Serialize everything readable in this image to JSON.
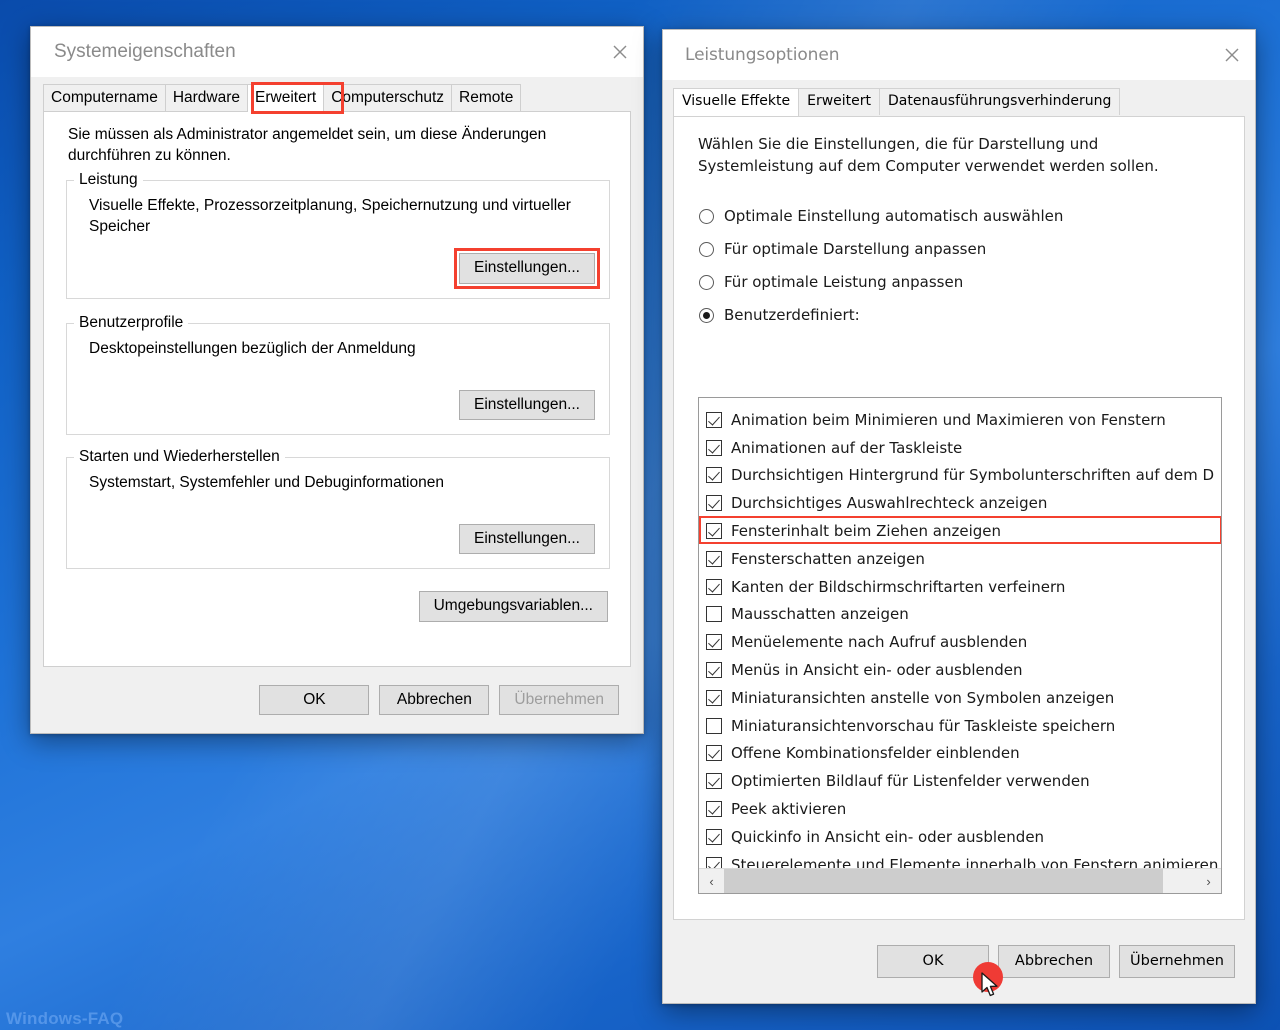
{
  "desktop": {
    "watermark": "Windows-FAQ"
  },
  "left_window": {
    "title": "Systemeigenschaften",
    "close_icon": "close-icon",
    "tabs": [
      {
        "label": "Computername",
        "active": false
      },
      {
        "label": "Hardware",
        "active": false
      },
      {
        "label": "Erweitert",
        "active": true,
        "highlighted": true
      },
      {
        "label": "Computerschutz",
        "active": false
      },
      {
        "label": "Remote",
        "active": false
      }
    ],
    "lead_text": "Sie müssen als Administrator angemeldet sein, um diese Änderungen durchführen zu können.",
    "groups": [
      {
        "legend": "Leistung",
        "description": "Visuelle Effekte, Prozessorzeitplanung, Speichernutzung und virtueller Speicher",
        "button": "Einstellungen...",
        "button_highlighted": true
      },
      {
        "legend": "Benutzerprofile",
        "description": "Desktopeinstellungen bezüglich der Anmeldung",
        "button": "Einstellungen...",
        "button_highlighted": false
      },
      {
        "legend": "Starten und Wiederherstellen",
        "description": "Systemstart, Systemfehler und Debuginformationen",
        "button": "Einstellungen...",
        "button_highlighted": false
      }
    ],
    "env_button": "Umgebungsvariablen...",
    "footer": {
      "ok": "OK",
      "cancel": "Abbrechen",
      "apply": "Übernehmen",
      "apply_disabled": true
    }
  },
  "right_window": {
    "title": "Leistungsoptionen",
    "close_icon": "close-icon",
    "tabs": [
      {
        "label": "Visuelle Effekte",
        "active": true
      },
      {
        "label": "Erweitert",
        "active": false
      },
      {
        "label": "Datenausführungsverhinderung",
        "active": false
      }
    ],
    "intro": "Wählen Sie die Einstellungen, die für Darstellung und Systemleistung auf dem Computer verwendet werden sollen.",
    "radios": [
      {
        "label": "Optimale Einstellung automatisch auswählen",
        "checked": false
      },
      {
        "label": "Für optimale Darstellung anpassen",
        "checked": false
      },
      {
        "label": "Für optimale Leistung anpassen",
        "checked": false
      },
      {
        "label": "Benutzerdefiniert:",
        "checked": true
      }
    ],
    "effects": [
      {
        "label": "Animation beim Minimieren und Maximieren von Fenstern",
        "checked": true,
        "highlighted": false
      },
      {
        "label": "Animationen auf der Taskleiste",
        "checked": true,
        "highlighted": false
      },
      {
        "label": "Durchsichtigen Hintergrund für Symbolunterschriften auf dem D",
        "checked": true,
        "highlighted": false
      },
      {
        "label": "Durchsichtiges Auswahlrechteck anzeigen",
        "checked": true,
        "highlighted": false
      },
      {
        "label": "Fensterinhalt beim Ziehen anzeigen",
        "checked": true,
        "highlighted": true
      },
      {
        "label": "Fensterschatten anzeigen",
        "checked": true,
        "highlighted": false
      },
      {
        "label": "Kanten der Bildschirmschriftarten verfeinern",
        "checked": true,
        "highlighted": false
      },
      {
        "label": "Mausschatten anzeigen",
        "checked": false,
        "highlighted": false
      },
      {
        "label": "Menüelemente nach Aufruf ausblenden",
        "checked": true,
        "highlighted": false
      },
      {
        "label": "Menüs in Ansicht ein- oder ausblenden",
        "checked": true,
        "highlighted": false
      },
      {
        "label": "Miniaturansichten anstelle von Symbolen anzeigen",
        "checked": true,
        "highlighted": false
      },
      {
        "label": "Miniaturansichtenvorschau für Taskleiste speichern",
        "checked": false,
        "highlighted": false
      },
      {
        "label": "Offene Kombinationsfelder einblenden",
        "checked": true,
        "highlighted": false
      },
      {
        "label": "Optimierten Bildlauf für Listenfelder verwenden",
        "checked": true,
        "highlighted": false
      },
      {
        "label": "Peek aktivieren",
        "checked": true,
        "highlighted": false
      },
      {
        "label": "Quickinfo in Ansicht ein- oder ausblenden",
        "checked": true,
        "highlighted": false
      },
      {
        "label": "Steuerelemente und Elemente innerhalb von Fenstern animieren",
        "checked": true,
        "highlighted": false
      }
    ],
    "scrollbar": {
      "left_arrow": "‹",
      "right_arrow": "›"
    },
    "footer": {
      "ok": "OK",
      "cancel": "Abbrechen",
      "apply": "Übernehmen"
    }
  },
  "annotations": {
    "accent_red": "#f4402f",
    "click_marker_color": "#ef3b35"
  }
}
